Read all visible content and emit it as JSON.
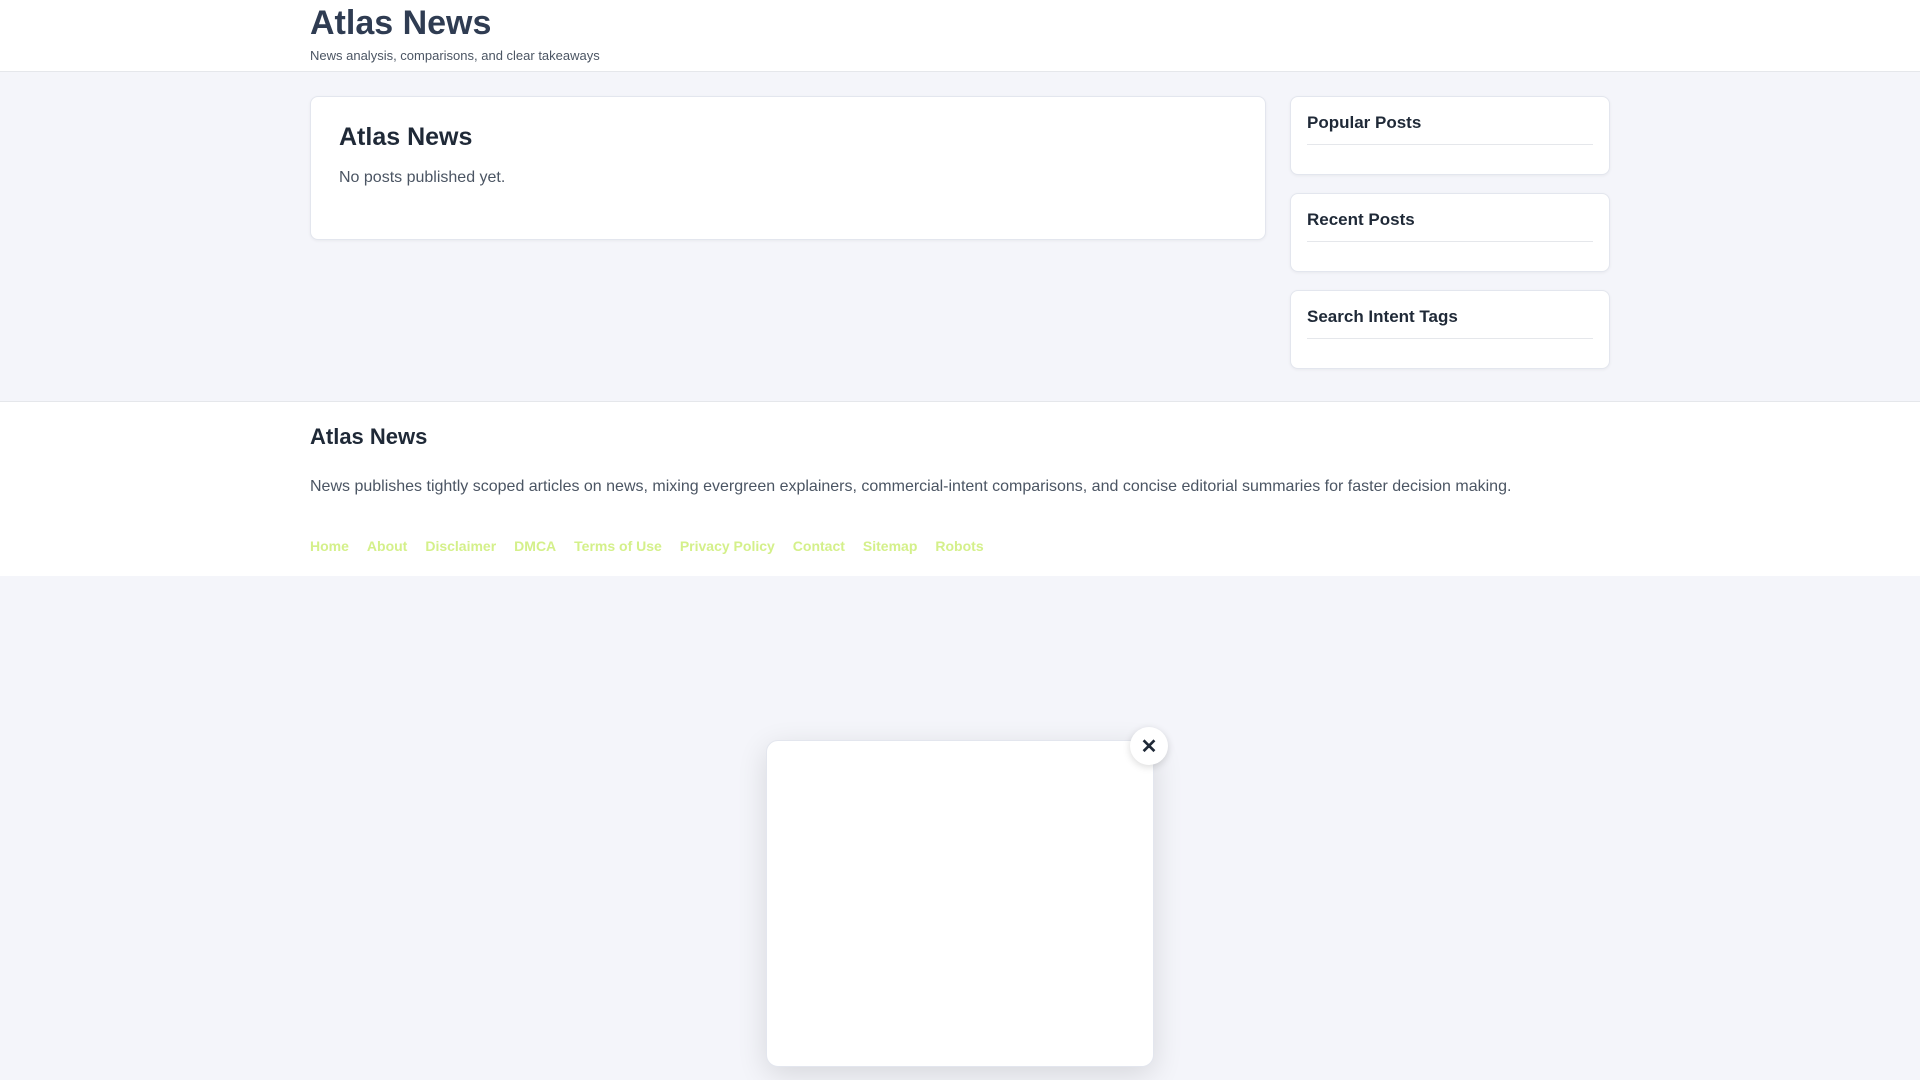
{
  "header": {
    "title": "Atlas News",
    "tagline": "News analysis, comparisons, and clear takeaways"
  },
  "main": {
    "title": "Atlas News",
    "empty_message": "No posts published yet."
  },
  "sidebar": {
    "widgets": [
      {
        "title": "Popular Posts"
      },
      {
        "title": "Recent Posts"
      },
      {
        "title": "Search Intent Tags"
      }
    ]
  },
  "footer": {
    "title": "Atlas News",
    "description": "News publishes tightly scoped articles on news, mixing evergreen explainers, commercial-intent comparisons, and concise editorial summaries for faster decision making.",
    "links": [
      "Home",
      "About",
      "Disclaimer",
      "DMCA",
      "Terms of Use",
      "Privacy Policy",
      "Contact",
      "Sitemap",
      "Robots"
    ],
    "link_color": "#d4f08a"
  },
  "popup": {
    "close_glyph": "✕"
  }
}
